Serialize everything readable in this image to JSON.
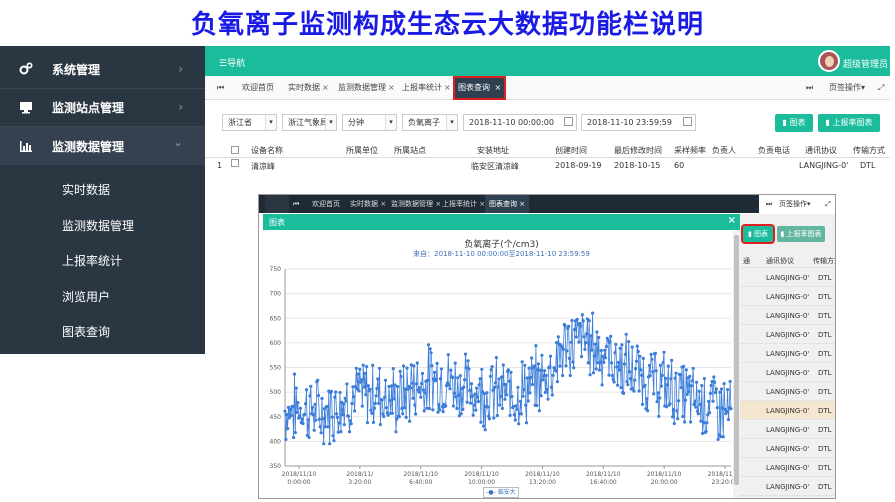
{
  "slide_title": "负氧离子监测构成生态云大数据功能栏说明",
  "sidebar": {
    "items": [
      {
        "label": "系统管理",
        "icon": "gears-icon",
        "arrow": "›"
      },
      {
        "label": "监测站点管理",
        "icon": "monitor-icon",
        "arrow": "›"
      },
      {
        "label": "监测数据管理",
        "icon": "bar-chart-icon",
        "arrow": "⌄"
      }
    ],
    "subitems": [
      "实时数据",
      "监测数据管理",
      "上报率统计",
      "浏览用户",
      "图表查询"
    ]
  },
  "topbar": {
    "nav_label": "☰导航",
    "user_label": "超级管理员"
  },
  "tabs": {
    "left_arrow": "⏮",
    "items": [
      "欢迎首页",
      "实时数据",
      "监测数据管理",
      "上报率统计"
    ],
    "close": "×",
    "active": "图表查询",
    "right_arrow": "⏭",
    "page_ops": "页签操作",
    "page_ops_caret": "▾",
    "fullscreen": "⤢"
  },
  "filters": {
    "province": "浙江省",
    "bureau": "浙江气象局",
    "interval": "分钟",
    "metric": "负氧离子",
    "start": "2018-11-10 00:00:00",
    "end": "2018-11-10 23:59:59",
    "chart_btn": "图表",
    "report_btn": "上报率图表",
    "caret": "▾"
  },
  "table": {
    "headers": [
      "设备名称",
      "所属单位",
      "所属站点",
      "安装地址",
      "创建时间",
      "最后修改时间",
      "采样频率",
      "负责人",
      "负责电话",
      "通讯协议",
      "传输方式"
    ],
    "row": {
      "index": "1",
      "name": "清凉峰",
      "address": "临安区清凉峰",
      "created": "2018-09-19",
      "modified": "2018-10-15",
      "rate": "60",
      "protocol": "LANGJING-0'",
      "transfer": "DTL"
    }
  },
  "overlay": {
    "tabs": [
      "欢迎首页",
      "实时数据",
      "监测数据管理",
      "上报率统计",
      "图表查询"
    ],
    "modal_title": "图表",
    "modal_close": "×",
    "chart_btn": "图表",
    "report_btn": "上报率图表",
    "col_label": "通讯协议",
    "col2_label": "传输方式",
    "col_partial": "通",
    "row_value": "LANGJING-0'",
    "row_value2": "DTL"
  },
  "chart_data": {
    "type": "line",
    "title": "负氧离子(个/cm3)",
    "subtitle": "来自：2018-11-10 00:00:00至2018-11-10 23:59:59",
    "ylim": [
      350,
      750
    ],
    "yticks": [
      350,
      400,
      450,
      500,
      550,
      600,
      650,
      700,
      750
    ],
    "xtick_labels": [
      [
        "2018/11/10",
        "0:00:00"
      ],
      [
        "2018/11/",
        "3:20:00"
      ],
      [
        "2018/11/10",
        "6:40:00"
      ],
      [
        "2018/11/10",
        "10:00:00"
      ],
      [
        "2018/11/10",
        "13:20:00"
      ],
      [
        "2018/11/10",
        "16:40:00"
      ],
      [
        "2018/11/10",
        "20:00:00"
      ],
      [
        "2018/11/10",
        "23:20:00"
      ]
    ],
    "series": [
      {
        "name": "临安大明",
        "color": "#3b7dd8"
      }
    ],
    "x_hours": [
      0,
      24
    ],
    "trend_hours": [
      0,
      1,
      2,
      3,
      4,
      5,
      6,
      7,
      8,
      9,
      10,
      11,
      12,
      13,
      14,
      15,
      16,
      17,
      18,
      19,
      20,
      21,
      22,
      23,
      24
    ],
    "trend_values": [
      460,
      470,
      455,
      480,
      495,
      500,
      480,
      515,
      530,
      520,
      505,
      500,
      495,
      505,
      530,
      590,
      610,
      585,
      555,
      535,
      520,
      500,
      485,
      475,
      460
    ],
    "grid": true
  }
}
